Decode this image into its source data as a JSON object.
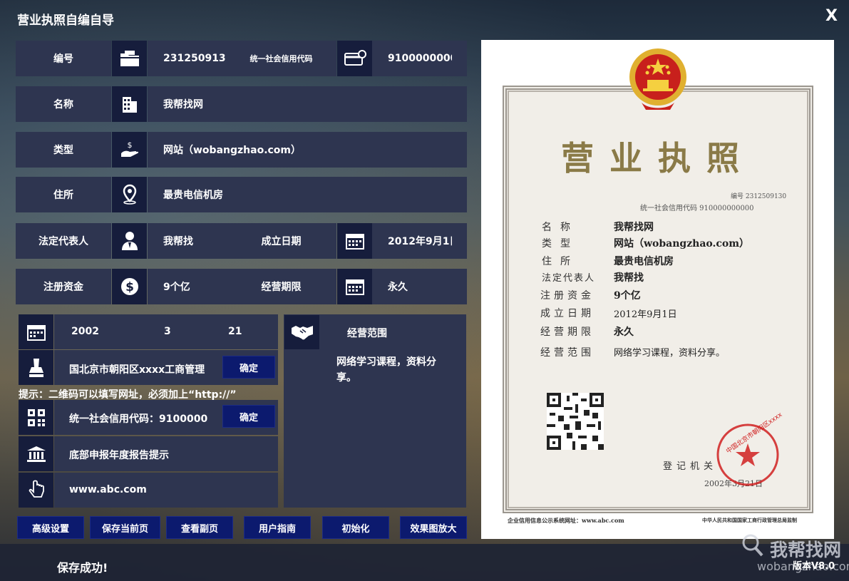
{
  "window": {
    "title": "营业执照自编自导",
    "close": "X"
  },
  "fields": {
    "number": {
      "label": "编号",
      "value": "2312509130",
      "icon": "folder-icon"
    },
    "credit_code": {
      "label": "统一社会信用代码",
      "value": "9100000000",
      "icon": "card-icon"
    },
    "name": {
      "label": "名称",
      "value": "我帮找网",
      "icon": "building-icon"
    },
    "type": {
      "label": "类型",
      "value": "网站（wobangzhao.com）",
      "icon": "money-hand-icon"
    },
    "address": {
      "label": "住所",
      "value": "最贵电信机房",
      "icon": "location-pin-icon"
    },
    "legal_rep": {
      "label": "法定代表人",
      "value": "我帮找",
      "icon": "person-icon"
    },
    "established": {
      "label": "成立日期",
      "value": "2012年9月1日",
      "icon": "calendar-icon"
    },
    "capital": {
      "label": "注册资金",
      "value": "9个亿",
      "icon": "dollar-coin-icon"
    },
    "term": {
      "label": "经营期限",
      "value": "永久",
      "icon": "calendar-icon"
    }
  },
  "date_row": {
    "year": "2002",
    "month": "3",
    "day": "21"
  },
  "authority": {
    "value": "国北京市朝阳区xxxx工商管理",
    "confirm": "确定"
  },
  "hint": "提示：二维码可以填写网址，必须加上“http://”",
  "qr": {
    "value": "统一社会信用代码：9100000",
    "confirm": "确定"
  },
  "bottom_notice": "底部申报年度报告提示",
  "website": "www.abc.com",
  "scope": {
    "label": "经营范围",
    "value": "网络学习课程，资料分享。"
  },
  "buttons": [
    "高级设置",
    "保存当前页",
    "查看副页",
    "用户指南",
    "初始化",
    "效果图放大"
  ],
  "status": "保存成功!",
  "version": "版本V8.0",
  "watermark": {
    "brand": "我帮找网",
    "url": "wobangzhao.com"
  },
  "certificate": {
    "title": "营业执照",
    "number_line": "编号 2312509130",
    "credit_line": "统一社会信用代码 910000000000",
    "rows": [
      {
        "label": "名称",
        "value": "我帮找网"
      },
      {
        "label": "类型",
        "value": "网站（wobangzhao.com）"
      },
      {
        "label": "住所",
        "value": "最贵电信机房"
      },
      {
        "label": "法定代表人",
        "value": "我帮找"
      },
      {
        "label": "注册资金",
        "value": "9个亿"
      },
      {
        "label": "成立日期",
        "value": "2012年9月1日"
      },
      {
        "label": "经营期限",
        "value": "永久"
      },
      {
        "label": "经营范围",
        "value": "网络学习课程，资料分享。"
      }
    ],
    "authority_label": "登记机关",
    "date": "2002年3月21日",
    "seal_text": "中国北京市朝阳区xxxx",
    "footer_left": "企业信用信息公示系统网址：www.abc.com",
    "footer_right": "中华人民共和国国家工商行政管理总局监制"
  },
  "colors": {
    "panel": "#2e3550",
    "icon_bg": "#161d3c",
    "button": "#0c1a6e",
    "title_gold": "#8a7a47",
    "seal_red": "#d02020"
  }
}
